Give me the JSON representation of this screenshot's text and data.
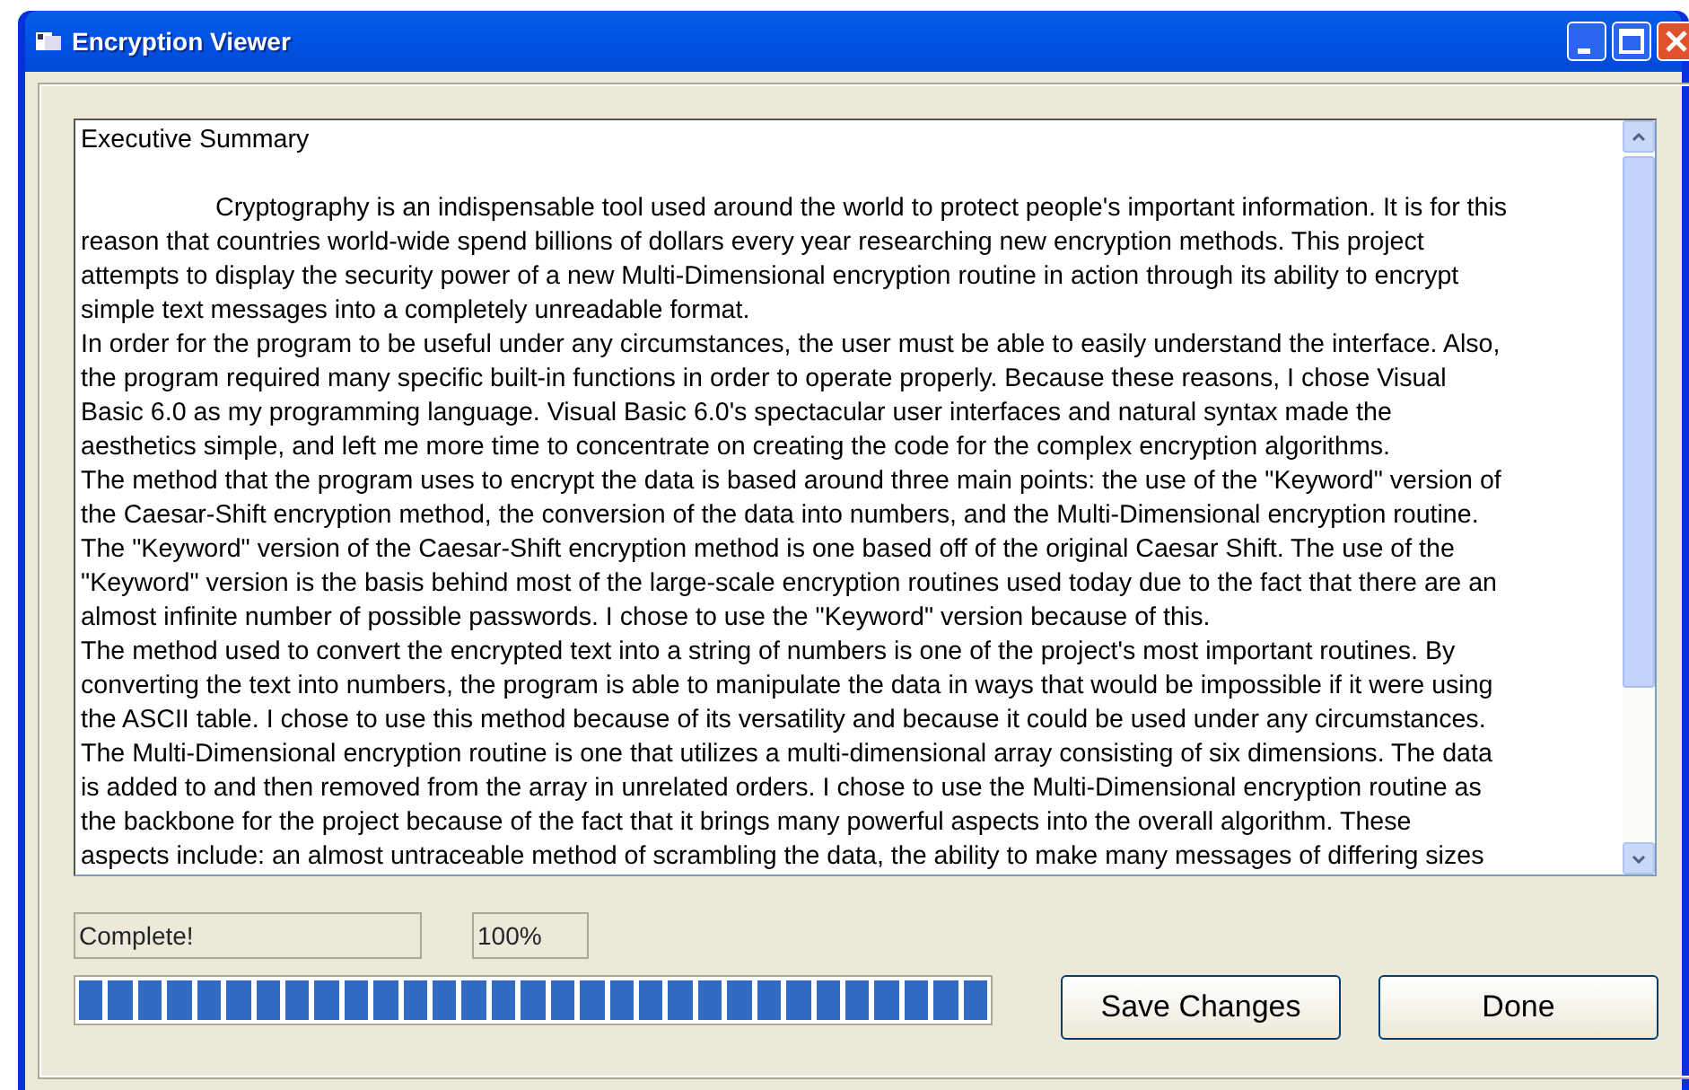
{
  "window": {
    "title": "Encryption Viewer"
  },
  "document": {
    "heading": "Executive Summary",
    "lines": [
      {
        "text": "Cryptography is an indispensable tool used around the world to protect people's important information. It is for this",
        "indent": true
      },
      {
        "text": "reason that countries world-wide spend billions of dollars every year researching new encryption methods. This project",
        "indent": false
      },
      {
        "text": "attempts to display the security power of a new Multi-Dimensional encryption routine in action through its ability to encrypt",
        "indent": false
      },
      {
        "text": "simple text messages into a completely unreadable format.",
        "indent": false
      },
      {
        "text": "In order for the program to be useful under any circumstances, the user must be able to easily understand the interface. Also,",
        "indent": false
      },
      {
        "text": "the program required many specific built-in functions in order to operate properly. Because these reasons, I chose Visual",
        "indent": false
      },
      {
        "text": "Basic 6.0 as my programming language. Visual Basic 6.0's spectacular user interfaces and natural syntax made the",
        "indent": false
      },
      {
        "text": "aesthetics simple, and left me more time to concentrate on creating the code for the complex encryption algorithms.",
        "indent": false
      },
      {
        "text": "The method that the program uses to encrypt the data is based around three main points: the use of the \"Keyword\" version of",
        "indent": false
      },
      {
        "text": "the Caesar-Shift encryption method, the conversion of the data into numbers, and the Multi-Dimensional encryption routine.",
        "indent": false
      },
      {
        "text": "The \"Keyword\" version of the Caesar-Shift encryption method is one based off of the original Caesar Shift. The use of the",
        "indent": false
      },
      {
        "text": "\"Keyword\" version is the basis behind most of the large-scale encryption routines used today due to the fact that there are an",
        "indent": false
      },
      {
        "text": "almost infinite number of possible passwords. I chose to use the \"Keyword\" version because of this.",
        "indent": false
      },
      {
        "text": "The method used to convert the encrypted text into a string of numbers is one of the project's most important routines. By",
        "indent": false
      },
      {
        "text": "converting the text into numbers, the program is able to manipulate the data in ways that would be impossible if it were using",
        "indent": false
      },
      {
        "text": "the ASCII table. I chose to use this method because of its versatility and because it could be used under any circumstances.",
        "indent": false
      },
      {
        "text": "The Multi-Dimensional encryption routine is one that utilizes a multi-dimensional array consisting of six dimensions. The data",
        "indent": false
      },
      {
        "text": "is added to and then removed from the array in unrelated orders. I chose to use the Multi-Dimensional encryption routine as",
        "indent": false
      },
      {
        "text": "the backbone for the project because of the fact that it brings many powerful aspects into the overall algorithm. These",
        "indent": false
      },
      {
        "text": "aspects include: an almost untraceable method of scrambling the data, the ability to make many messages of differing sizes",
        "indent": false
      }
    ]
  },
  "status": {
    "message": "Complete!",
    "percent": "100%"
  },
  "progress": {
    "level": 1.0
  },
  "buttons": [
    "Save Changes",
    "Done"
  ]
}
